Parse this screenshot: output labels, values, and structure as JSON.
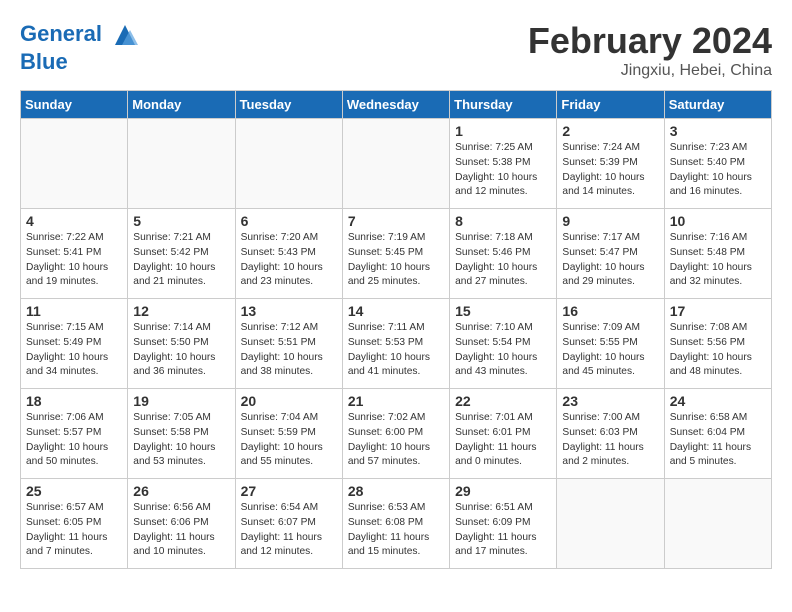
{
  "header": {
    "logo_line1": "General",
    "logo_line2": "Blue",
    "month": "February 2024",
    "location": "Jingxiu, Hebei, China"
  },
  "weekdays": [
    "Sunday",
    "Monday",
    "Tuesday",
    "Wednesday",
    "Thursday",
    "Friday",
    "Saturday"
  ],
  "weeks": [
    [
      {
        "day": "",
        "info": ""
      },
      {
        "day": "",
        "info": ""
      },
      {
        "day": "",
        "info": ""
      },
      {
        "day": "",
        "info": ""
      },
      {
        "day": "1",
        "info": "Sunrise: 7:25 AM\nSunset: 5:38 PM\nDaylight: 10 hours\nand 12 minutes."
      },
      {
        "day": "2",
        "info": "Sunrise: 7:24 AM\nSunset: 5:39 PM\nDaylight: 10 hours\nand 14 minutes."
      },
      {
        "day": "3",
        "info": "Sunrise: 7:23 AM\nSunset: 5:40 PM\nDaylight: 10 hours\nand 16 minutes."
      }
    ],
    [
      {
        "day": "4",
        "info": "Sunrise: 7:22 AM\nSunset: 5:41 PM\nDaylight: 10 hours\nand 19 minutes."
      },
      {
        "day": "5",
        "info": "Sunrise: 7:21 AM\nSunset: 5:42 PM\nDaylight: 10 hours\nand 21 minutes."
      },
      {
        "day": "6",
        "info": "Sunrise: 7:20 AM\nSunset: 5:43 PM\nDaylight: 10 hours\nand 23 minutes."
      },
      {
        "day": "7",
        "info": "Sunrise: 7:19 AM\nSunset: 5:45 PM\nDaylight: 10 hours\nand 25 minutes."
      },
      {
        "day": "8",
        "info": "Sunrise: 7:18 AM\nSunset: 5:46 PM\nDaylight: 10 hours\nand 27 minutes."
      },
      {
        "day": "9",
        "info": "Sunrise: 7:17 AM\nSunset: 5:47 PM\nDaylight: 10 hours\nand 29 minutes."
      },
      {
        "day": "10",
        "info": "Sunrise: 7:16 AM\nSunset: 5:48 PM\nDaylight: 10 hours\nand 32 minutes."
      }
    ],
    [
      {
        "day": "11",
        "info": "Sunrise: 7:15 AM\nSunset: 5:49 PM\nDaylight: 10 hours\nand 34 minutes."
      },
      {
        "day": "12",
        "info": "Sunrise: 7:14 AM\nSunset: 5:50 PM\nDaylight: 10 hours\nand 36 minutes."
      },
      {
        "day": "13",
        "info": "Sunrise: 7:12 AM\nSunset: 5:51 PM\nDaylight: 10 hours\nand 38 minutes."
      },
      {
        "day": "14",
        "info": "Sunrise: 7:11 AM\nSunset: 5:53 PM\nDaylight: 10 hours\nand 41 minutes."
      },
      {
        "day": "15",
        "info": "Sunrise: 7:10 AM\nSunset: 5:54 PM\nDaylight: 10 hours\nand 43 minutes."
      },
      {
        "day": "16",
        "info": "Sunrise: 7:09 AM\nSunset: 5:55 PM\nDaylight: 10 hours\nand 45 minutes."
      },
      {
        "day": "17",
        "info": "Sunrise: 7:08 AM\nSunset: 5:56 PM\nDaylight: 10 hours\nand 48 minutes."
      }
    ],
    [
      {
        "day": "18",
        "info": "Sunrise: 7:06 AM\nSunset: 5:57 PM\nDaylight: 10 hours\nand 50 minutes."
      },
      {
        "day": "19",
        "info": "Sunrise: 7:05 AM\nSunset: 5:58 PM\nDaylight: 10 hours\nand 53 minutes."
      },
      {
        "day": "20",
        "info": "Sunrise: 7:04 AM\nSunset: 5:59 PM\nDaylight: 10 hours\nand 55 minutes."
      },
      {
        "day": "21",
        "info": "Sunrise: 7:02 AM\nSunset: 6:00 PM\nDaylight: 10 hours\nand 57 minutes."
      },
      {
        "day": "22",
        "info": "Sunrise: 7:01 AM\nSunset: 6:01 PM\nDaylight: 11 hours\nand 0 minutes."
      },
      {
        "day": "23",
        "info": "Sunrise: 7:00 AM\nSunset: 6:03 PM\nDaylight: 11 hours\nand 2 minutes."
      },
      {
        "day": "24",
        "info": "Sunrise: 6:58 AM\nSunset: 6:04 PM\nDaylight: 11 hours\nand 5 minutes."
      }
    ],
    [
      {
        "day": "25",
        "info": "Sunrise: 6:57 AM\nSunset: 6:05 PM\nDaylight: 11 hours\nand 7 minutes."
      },
      {
        "day": "26",
        "info": "Sunrise: 6:56 AM\nSunset: 6:06 PM\nDaylight: 11 hours\nand 10 minutes."
      },
      {
        "day": "27",
        "info": "Sunrise: 6:54 AM\nSunset: 6:07 PM\nDaylight: 11 hours\nand 12 minutes."
      },
      {
        "day": "28",
        "info": "Sunrise: 6:53 AM\nSunset: 6:08 PM\nDaylight: 11 hours\nand 15 minutes."
      },
      {
        "day": "29",
        "info": "Sunrise: 6:51 AM\nSunset: 6:09 PM\nDaylight: 11 hours\nand 17 minutes."
      },
      {
        "day": "",
        "info": ""
      },
      {
        "day": "",
        "info": ""
      }
    ]
  ]
}
